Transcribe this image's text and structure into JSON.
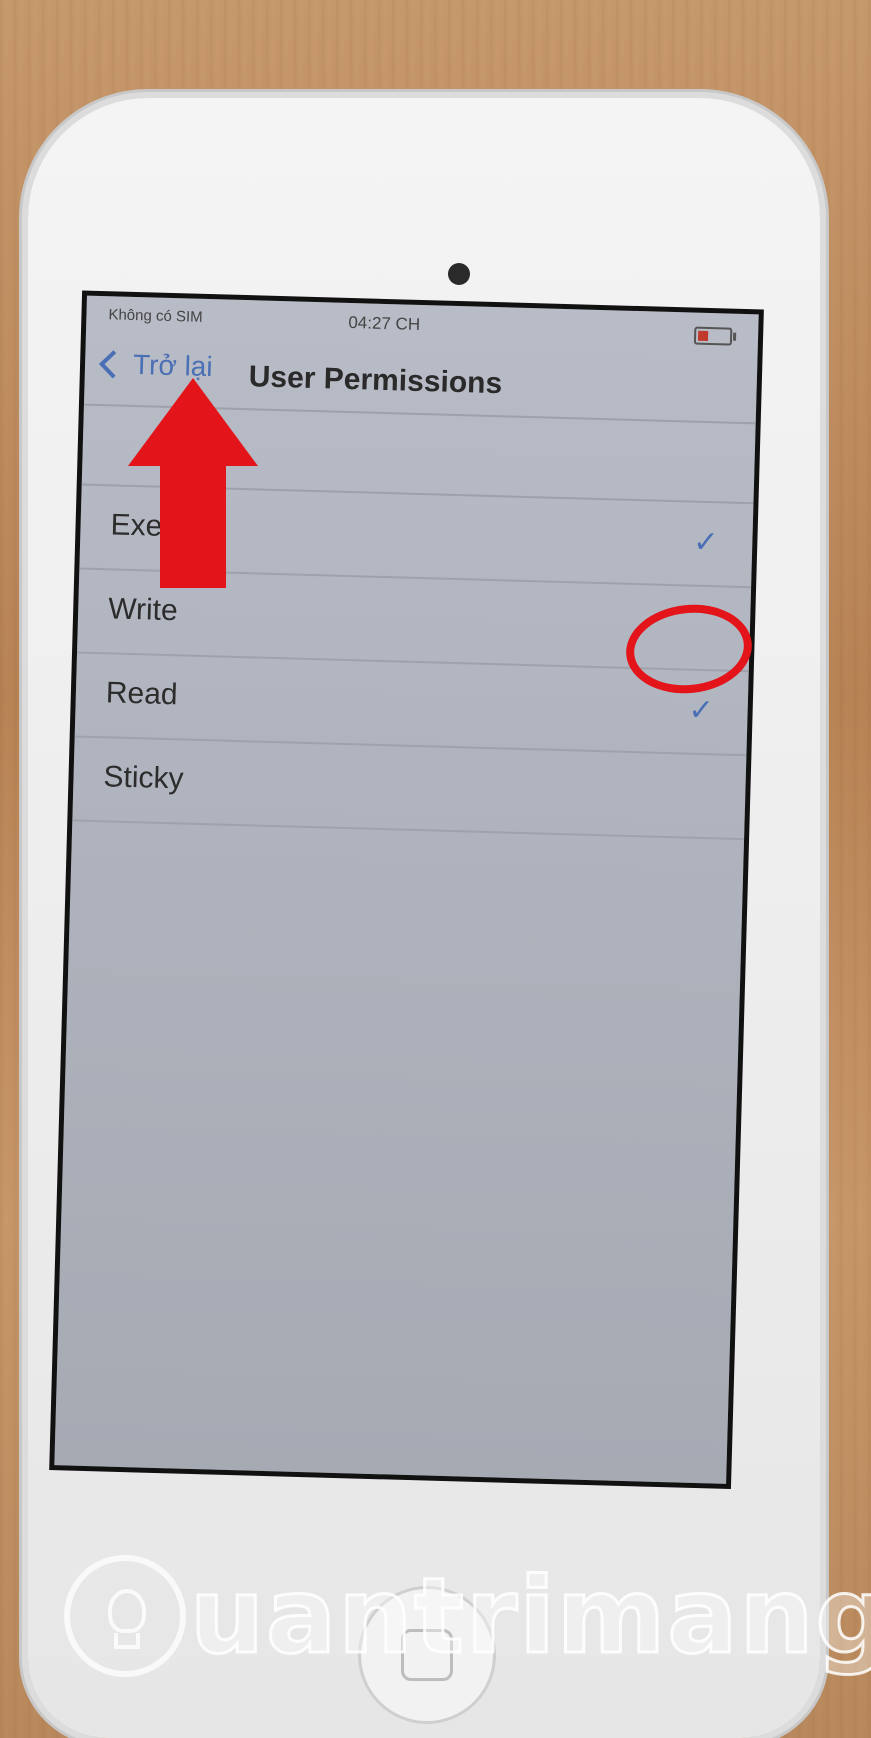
{
  "status_bar": {
    "carrier": "Không có SIM",
    "time": "04:27 CH"
  },
  "nav_bar": {
    "back_label": "Trở lại",
    "title": "User Permissions"
  },
  "permissions": [
    {
      "label": "Execute",
      "checked": true
    },
    {
      "label": "Write",
      "checked": false
    },
    {
      "label": "Read",
      "checked": true
    },
    {
      "label": "Sticky",
      "checked": false
    }
  ],
  "checkmark_glyph": "✓",
  "annotation_colors": {
    "arrow": "#e3141a",
    "circle": "#e3141a"
  },
  "watermark": {
    "text": "uantrimang"
  }
}
